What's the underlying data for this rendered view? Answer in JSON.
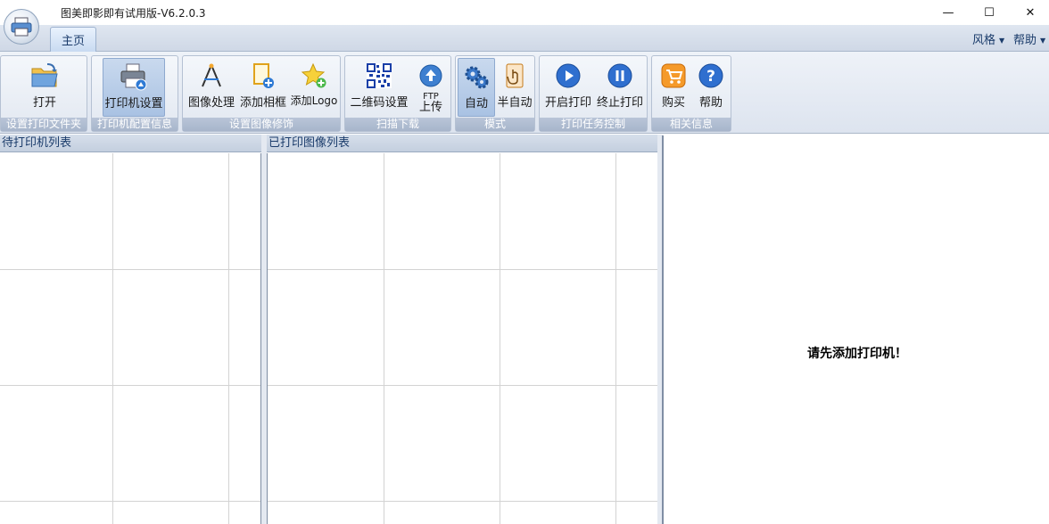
{
  "window": {
    "title": "图美即影即有试用版-V6.2.0.3",
    "controls": {
      "minimize": "—",
      "maximize": "☐",
      "close": "✕"
    }
  },
  "tabs": {
    "home": "主页",
    "style": "风格",
    "help": "帮助"
  },
  "ribbon": {
    "groups": [
      {
        "label": "设置打印文件夹",
        "buttons": [
          {
            "label": "打开",
            "icon": "folder-open-icon"
          }
        ]
      },
      {
        "label": "打印机配置信息",
        "buttons": [
          {
            "label": "打印机设置",
            "icon": "printer-settings-icon"
          }
        ]
      },
      {
        "label": "设置图像修饰",
        "buttons": [
          {
            "label": "图像处理",
            "icon": "image-process-icon"
          },
          {
            "label": "添加相框",
            "icon": "add-frame-icon"
          },
          {
            "label": "添加Logo",
            "icon": "add-logo-icon"
          }
        ]
      },
      {
        "label": "扫描下载",
        "buttons": [
          {
            "label": "二维码设置",
            "icon": "qrcode-icon"
          },
          {
            "label": "FTP",
            "label2": "上传",
            "icon": "upload-icon"
          }
        ]
      },
      {
        "label": "模式",
        "buttons": [
          {
            "label": "自动",
            "icon": "gears-icon"
          },
          {
            "label": "半自动",
            "icon": "hand-icon"
          }
        ]
      },
      {
        "label": "打印任务控制",
        "buttons": [
          {
            "label": "开启打印",
            "icon": "play-icon"
          },
          {
            "label": "终止打印",
            "icon": "pause-icon"
          }
        ]
      },
      {
        "label": "相关信息",
        "buttons": [
          {
            "label": "购买",
            "icon": "cart-icon"
          },
          {
            "label": "帮助",
            "icon": "help-icon"
          }
        ]
      }
    ]
  },
  "panels": {
    "pending_printers": "待打印机列表",
    "printed_images": "已打印图像列表"
  },
  "preview": {
    "message": "请先添加打印机！"
  },
  "colors": {
    "accent": "#1b3c6b",
    "ribbon_bg": "#e2e8f1",
    "group_label_bg": "#a7b5cb"
  }
}
